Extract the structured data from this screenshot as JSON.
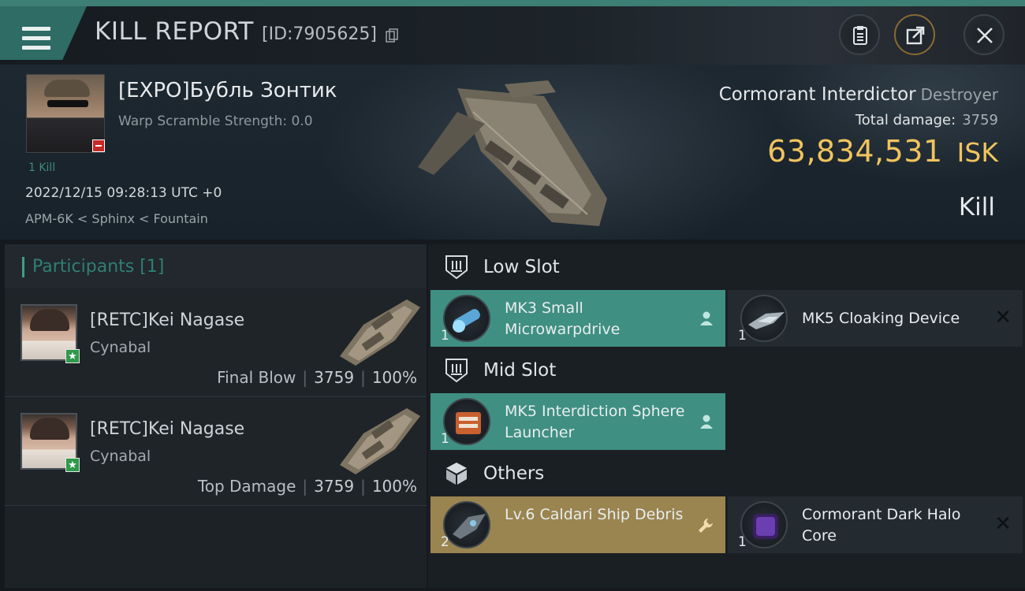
{
  "header": {
    "title": "KILL REPORT",
    "report_id": "[ID:7905625]"
  },
  "victim": {
    "name": "[EXPO]Бубль Зонтик",
    "warp_scramble": "Warp Scramble Strength: 0.0",
    "kill_count": "1 Kill",
    "timestamp": "2022/12/15 09:28:13 UTC +0",
    "location": "APM-6K < Sphinx < Fountain"
  },
  "ship": {
    "name": "Cormorant Interdictor",
    "class": "Destroyer",
    "total_damage_label": "Total damage:",
    "total_damage_value": "3759",
    "isk_value": "63,834,531",
    "isk_unit": "ISK",
    "result": "Kill"
  },
  "participants": {
    "title": "Participants [1]",
    "items": [
      {
        "name": "[RETC]Kei Nagase",
        "ship": "Cynabal",
        "tag": "Final Blow",
        "damage": "3759",
        "percent": "100%"
      },
      {
        "name": "[RETC]Kei Nagase",
        "ship": "Cynabal",
        "tag": "Top Damage",
        "damage": "3759",
        "percent": "100%"
      }
    ]
  },
  "slots": {
    "low": {
      "title": "Low Slot",
      "modules": [
        {
          "name": "MK3 Small Microwarpdrive",
          "qty": "1",
          "state": "teal"
        },
        {
          "name": "MK5 Cloaking Device",
          "qty": "1",
          "state": "dark"
        }
      ]
    },
    "mid": {
      "title": "Mid Slot",
      "modules": [
        {
          "name": "MK5 Interdiction Sphere Launcher",
          "qty": "1",
          "state": "teal"
        }
      ]
    },
    "others": {
      "title": "Others",
      "modules": [
        {
          "name": "Lv.6 Caldari Ship Debris",
          "qty": "2",
          "state": "gold"
        },
        {
          "name": "Cormorant Dark Halo Core",
          "qty": "1",
          "state": "dark"
        }
      ]
    }
  },
  "colors": {
    "accent_teal": "#3f8f82",
    "isk_gold": "#f0c45d",
    "dropped_gold": "#9a8450"
  }
}
